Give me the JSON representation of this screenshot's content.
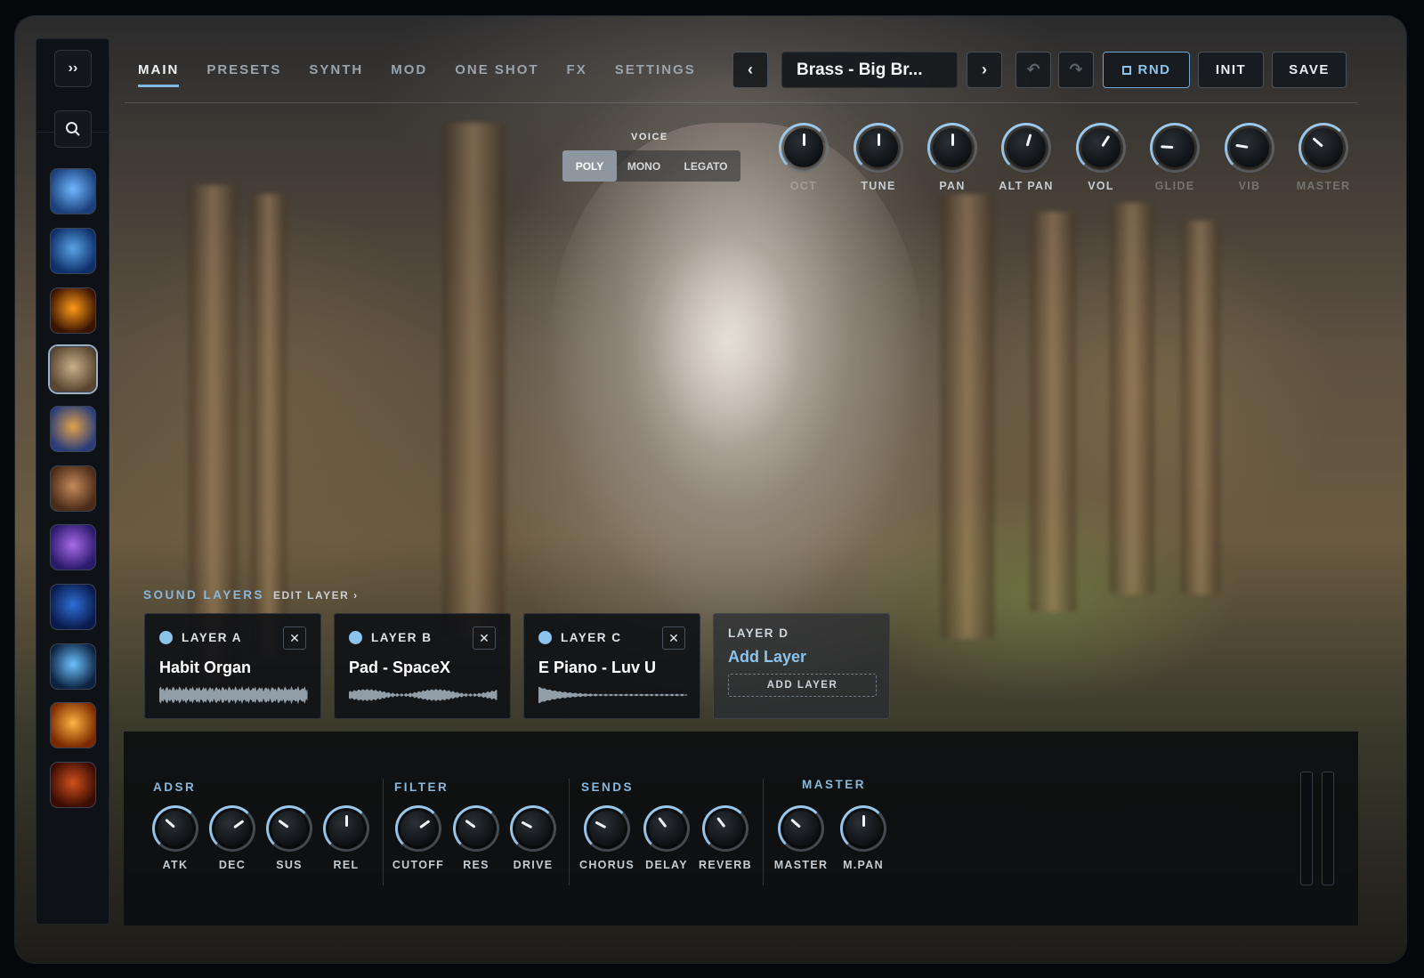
{
  "sidebar": {
    "expand_icon": "double-chevron-right-icon",
    "search_icon": "search-icon",
    "expand_glyph": "››",
    "thumbnails": [
      {
        "name": "expansion-1",
        "colors": [
          "#1b3f7a",
          "#6fb7ff"
        ],
        "active": false
      },
      {
        "name": "expansion-2",
        "colors": [
          "#0f2f6a",
          "#59a4e6"
        ],
        "active": false
      },
      {
        "name": "expansion-3",
        "colors": [
          "#3a1400",
          "#ff9a1a"
        ],
        "active": false
      },
      {
        "name": "expansion-4",
        "colors": [
          "#5a4630",
          "#c8b08c"
        ],
        "active": true
      },
      {
        "name": "expansion-5",
        "colors": [
          "#2a3d7a",
          "#e0a14a"
        ],
        "active": false
      },
      {
        "name": "expansion-6",
        "colors": [
          "#4a2a18",
          "#c48a5a"
        ],
        "active": false
      },
      {
        "name": "expansion-7",
        "colors": [
          "#2a1a6a",
          "#a86ae8"
        ],
        "active": false
      },
      {
        "name": "expansion-8",
        "colors": [
          "#0a1a4a",
          "#2e6fd8"
        ],
        "active": false
      },
      {
        "name": "expansion-9",
        "colors": [
          "#0c2240",
          "#6cc2ff"
        ],
        "active": false
      },
      {
        "name": "expansion-10",
        "colors": [
          "#7a2a00",
          "#ffb340"
        ],
        "active": false
      },
      {
        "name": "expansion-11",
        "colors": [
          "#3a0c04",
          "#d0501a"
        ],
        "active": false
      }
    ]
  },
  "tabs": [
    {
      "label": "MAIN",
      "active": true
    },
    {
      "label": "PRESETS",
      "active": false
    },
    {
      "label": "SYNTH",
      "active": false
    },
    {
      "label": "MOD",
      "active": false
    },
    {
      "label": "ONE SHOT",
      "active": false
    },
    {
      "label": "FX",
      "active": false
    },
    {
      "label": "SETTINGS",
      "active": false
    }
  ],
  "preset": {
    "name": "Brass - Big Br...",
    "prev_glyph": "‹",
    "next_glyph": "›",
    "undo_glyph": "↶",
    "redo_glyph": "↷",
    "rnd_label": "RND",
    "init_label": "INIT",
    "save_label": "SAVE"
  },
  "voice": {
    "label": "VOICE",
    "modes": [
      "POLY",
      "MONO",
      "LEGATO"
    ],
    "selected": "POLY"
  },
  "top_knobs": [
    {
      "label": "OCT",
      "value": 0.5,
      "faint": true
    },
    {
      "label": "TUNE",
      "value": 0.5,
      "faint": false
    },
    {
      "label": "PAN",
      "value": 0.5,
      "faint": false
    },
    {
      "label": "ALT PAN",
      "value": 0.56,
      "faint": false
    },
    {
      "label": "VOL",
      "value": 0.62,
      "faint": false
    },
    {
      "label": "GLIDE",
      "value": 0.18,
      "faint": true
    },
    {
      "label": "VIB",
      "value": 0.2,
      "faint": true
    },
    {
      "label": "MASTER",
      "value": 0.32,
      "faint": true
    }
  ],
  "sound_layers": {
    "title": "SOUND LAYERS",
    "edit_label": "EDIT LAYER ›",
    "close_glyph": "✕",
    "layers": [
      {
        "name": "LAYER A",
        "preset": "Habit Organ",
        "wave": "dense"
      },
      {
        "name": "LAYER B",
        "preset": "Pad - SpaceX",
        "wave": "soft"
      },
      {
        "name": "LAYER C",
        "preset": "E Piano - Luv U",
        "wave": "decay"
      }
    ],
    "empty_layer": {
      "name": "LAYER D",
      "add_text": "Add Layer",
      "button": "ADD LAYER"
    }
  },
  "bottom": {
    "sections": [
      {
        "title": "ADSR",
        "knobs": [
          {
            "label": "ATK",
            "value": 0.32
          },
          {
            "label": "DEC",
            "value": 0.7
          },
          {
            "label": "SUS",
            "value": 0.3
          },
          {
            "label": "REL",
            "value": 0.5
          }
        ]
      },
      {
        "title": "FILTER",
        "knobs": [
          {
            "label": "CUTOFF",
            "value": 0.7
          },
          {
            "label": "RES",
            "value": 0.3
          },
          {
            "label": "DRIVE",
            "value": 0.27
          }
        ]
      },
      {
        "title": "SENDS",
        "knobs": [
          {
            "label": "CHORUS",
            "value": 0.27
          },
          {
            "label": "DELAY",
            "value": 0.36
          },
          {
            "label": "REVERB",
            "value": 0.36
          }
        ]
      },
      {
        "title": "MASTER",
        "knobs": [
          {
            "label": "MASTER",
            "value": 0.32
          },
          {
            "label": "M.PAN",
            "value": 0.5
          }
        ]
      }
    ]
  }
}
